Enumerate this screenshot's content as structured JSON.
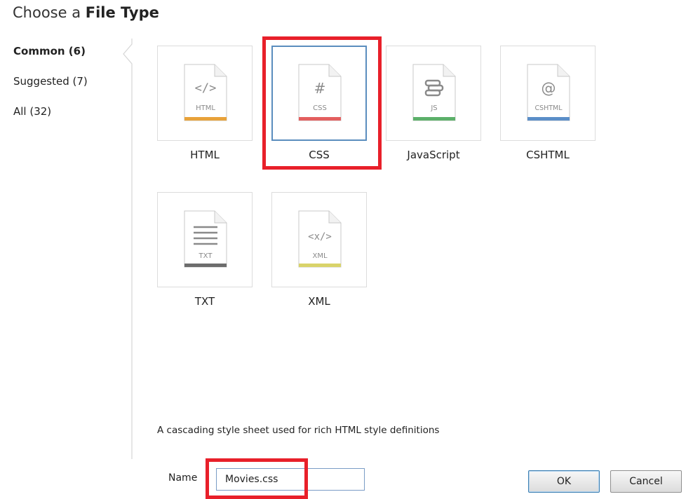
{
  "title": {
    "prefix": "Choose a",
    "bold": "File Type"
  },
  "categories": [
    {
      "label": "Common (6)",
      "active": true
    },
    {
      "label": "Suggested (7)",
      "active": false
    },
    {
      "label": "All (32)",
      "active": false
    }
  ],
  "file_types": [
    {
      "label": "HTML",
      "icon_text": "HTML",
      "glyph": "</>",
      "band_color": "#e8a23a",
      "selected": false
    },
    {
      "label": "CSS",
      "icon_text": "CSS",
      "glyph": "#",
      "band_color": "#e35f5f",
      "selected": true
    },
    {
      "label": "JavaScript",
      "icon_text": "JS",
      "glyph": "scroll",
      "band_color": "#5cb06a",
      "selected": false
    },
    {
      "label": "CSHTML",
      "icon_text": "CSHTML",
      "glyph": "@",
      "band_color": "#5b8ec8",
      "selected": false
    },
    {
      "label": "TXT",
      "icon_text": "TXT",
      "glyph": "lines",
      "band_color": "#6d6d6d",
      "selected": false
    },
    {
      "label": "XML",
      "icon_text": "XML",
      "glyph": "<x/>",
      "band_color": "#d9d36a",
      "selected": false
    }
  ],
  "description": "A cascading style sheet used for rich HTML style definitions",
  "name_field": {
    "label": "Name",
    "value": "Movies.css"
  },
  "buttons": {
    "ok": "OK",
    "cancel": "Cancel"
  },
  "colors": {
    "highlight": "#e8202a",
    "selection": "#5a8dbe"
  }
}
